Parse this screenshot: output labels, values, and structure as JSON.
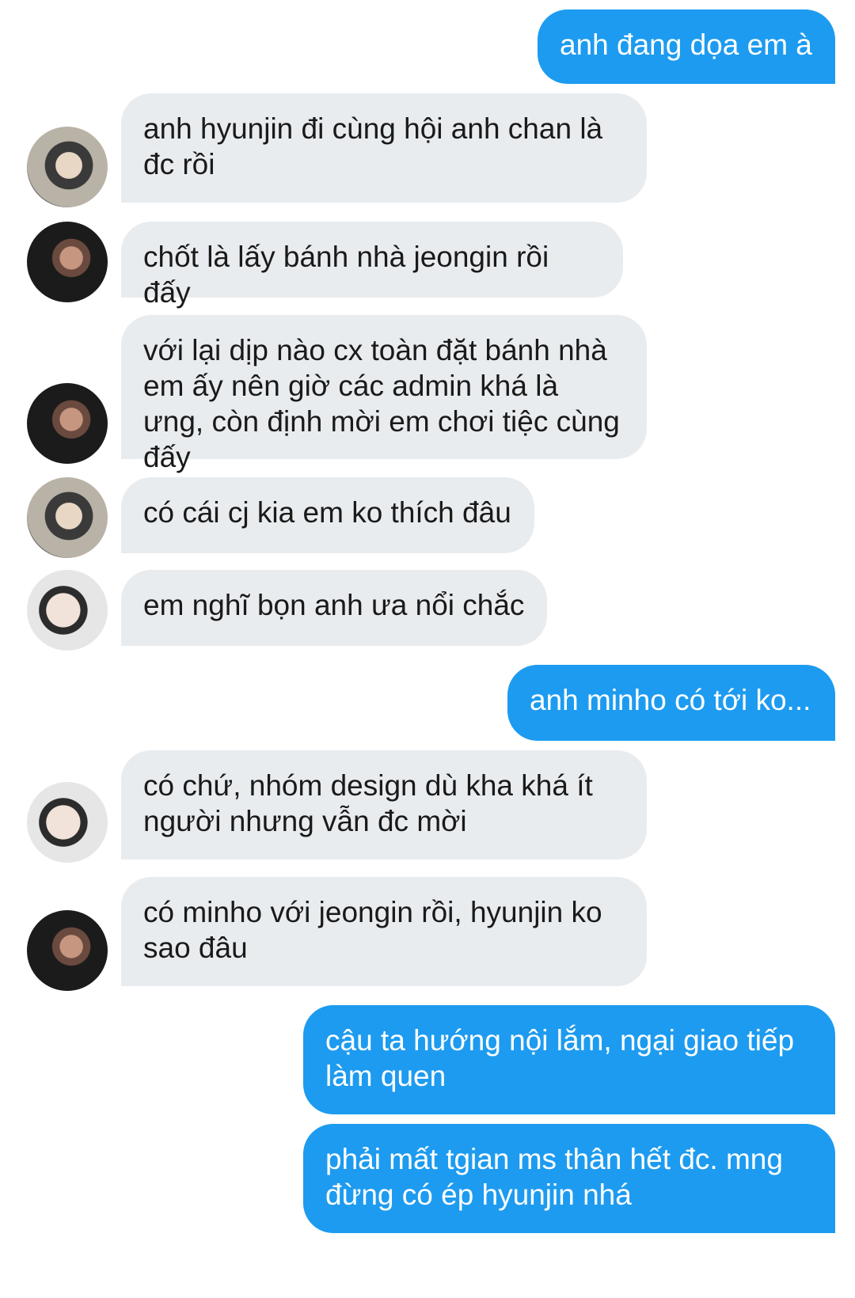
{
  "messages": [
    {
      "side": "out",
      "text": "anh đang dọa em à"
    },
    {
      "side": "in",
      "avatar": "av1",
      "text": "anh hyunjin đi cùng hội anh chan là đc rồi"
    },
    {
      "side": "in",
      "avatar": "av2",
      "text": "chốt là lấy bánh nhà jeongin rồi đấy"
    },
    {
      "side": "in",
      "avatar": "av2",
      "text": "với lại dịp nào cx toàn đặt bánh nhà em ấy nên giờ các admin khá là ưng, còn định mời em chơi tiệc cùng đấy"
    },
    {
      "side": "in",
      "avatar": "av1",
      "text": "có cái cj kia em ko thích đâu"
    },
    {
      "side": "in",
      "avatar": "av3",
      "text": "em nghĩ bọn anh ưa nổi chắc"
    },
    {
      "side": "out",
      "text": "anh minho có tới ko..."
    },
    {
      "side": "in",
      "avatar": "av3",
      "text": "có chứ, nhóm design dù kha khá ít người nhưng vẫn đc mời"
    },
    {
      "side": "in",
      "avatar": "av2",
      "text": "có minho với jeongin rồi, hyunjin ko sao đâu"
    },
    {
      "side": "out",
      "text": "cậu ta hướng nội lắm, ngại giao tiếp làm quen"
    },
    {
      "side": "out",
      "text": "phải mất tgian ms thân hết đc. mng đừng có ép hyunjin nhá"
    }
  ]
}
